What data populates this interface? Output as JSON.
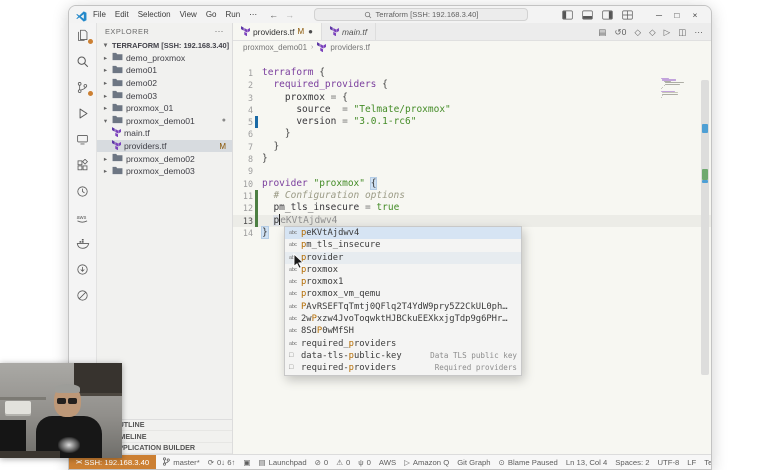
{
  "title_bar": {
    "menus": [
      "File",
      "Edit",
      "Selection",
      "View",
      "Go",
      "Run"
    ],
    "more_menu": "⋯",
    "back_arrow": "←",
    "forward_arrow": "→",
    "search_text": "Terraform [SSH: 192.168.3.40]",
    "window_controls": {
      "minimize": "─",
      "maximize": "□",
      "close": "×"
    }
  },
  "activity_bar": [
    {
      "name": "explorer",
      "badge": true
    },
    {
      "name": "search",
      "badge": false
    },
    {
      "name": "source-control",
      "badge": true
    },
    {
      "name": "run-debug",
      "badge": false
    },
    {
      "name": "remote-explorer",
      "badge": false
    },
    {
      "name": "extensions",
      "badge": false
    },
    {
      "name": "clock",
      "badge": false
    },
    {
      "name": "aws",
      "badge": false
    },
    {
      "name": "docker",
      "badge": false
    },
    {
      "name": "circle-arrow",
      "badge": false
    },
    {
      "name": "blocked-circle",
      "badge": false
    }
  ],
  "explorer": {
    "header": "EXPLORER",
    "header_more": "⋯",
    "root": "TERRAFORM [SSH: 192.168.3.40]",
    "items": [
      {
        "label": "demo_proxmox",
        "kind": "folder"
      },
      {
        "label": "demo01",
        "kind": "folder"
      },
      {
        "label": "demo02",
        "kind": "folder"
      },
      {
        "label": "demo03",
        "kind": "folder"
      },
      {
        "label": "proxmox_01",
        "kind": "folder"
      },
      {
        "label": "proxmox_demo01",
        "kind": "folder",
        "expanded": true,
        "dirty": true
      },
      {
        "label": "main.tf",
        "kind": "file",
        "depth": 1
      },
      {
        "label": "providers.tf",
        "kind": "file",
        "depth": 1,
        "selected": true,
        "git": "M"
      },
      {
        "label": "proxmox_demo02",
        "kind": "folder"
      },
      {
        "label": "proxmox_demo03",
        "kind": "folder"
      }
    ],
    "bottom_sections": [
      "OUTLINE",
      "TIMELINE",
      "APPLICATION BUILDER"
    ]
  },
  "editor": {
    "tabs": [
      {
        "label": "providers.tf",
        "git": "M",
        "dirty": true,
        "active": true
      },
      {
        "label": "main.tf",
        "preview": true
      }
    ],
    "actions": [
      "▤",
      "↺0",
      "◇",
      "◇",
      "▷",
      "◫",
      "⋯"
    ],
    "breadcrumb": [
      "proxmox_demo01",
      "providers.tf"
    ],
    "code_lines": [
      {
        "n": 1,
        "tokens": [
          [
            "kw",
            "terraform"
          ],
          [
            "pun",
            " {"
          ]
        ]
      },
      {
        "n": 2,
        "tokens": [
          [
            "pun",
            "  "
          ],
          [
            "kw",
            "required_providers"
          ],
          [
            "pun",
            " {"
          ]
        ]
      },
      {
        "n": 3,
        "tokens": [
          [
            "pun",
            "    "
          ],
          [
            "prop",
            "proxmox"
          ],
          [
            "op",
            " = "
          ],
          [
            "pun",
            "{"
          ]
        ]
      },
      {
        "n": 4,
        "tokens": [
          [
            "pun",
            "      "
          ],
          [
            "prop",
            "source"
          ],
          [
            "op",
            "  = "
          ],
          [
            "str",
            "\"Telmate/proxmox\""
          ]
        ]
      },
      {
        "n": 5,
        "mark": "mod",
        "tokens": [
          [
            "pun",
            "      "
          ],
          [
            "prop",
            "version"
          ],
          [
            "op",
            " = "
          ],
          [
            "str",
            "\"3.0.1-rc6\""
          ]
        ]
      },
      {
        "n": 6,
        "tokens": [
          [
            "pun",
            "    }"
          ]
        ]
      },
      {
        "n": 7,
        "tokens": [
          [
            "pun",
            "  }"
          ]
        ]
      },
      {
        "n": 8,
        "tokens": [
          [
            "pun",
            "}"
          ]
        ]
      },
      {
        "n": 9,
        "tokens": []
      },
      {
        "n": 10,
        "tokens": [
          [
            "kw",
            "provider"
          ],
          [
            "pun",
            " "
          ],
          [
            "str",
            "\"proxmox\""
          ],
          [
            "pun",
            " "
          ],
          [
            "brh",
            "{"
          ]
        ]
      },
      {
        "n": 11,
        "mark": "add",
        "tokens": [
          [
            "pun",
            "  "
          ],
          [
            "com",
            "# Configuration options"
          ]
        ]
      },
      {
        "n": 12,
        "mark": "add",
        "tokens": [
          [
            "pun",
            "  "
          ],
          [
            "prop",
            "pm_tls_insecure"
          ],
          [
            "op",
            " = "
          ],
          [
            "bool",
            "true"
          ]
        ]
      },
      {
        "n": 13,
        "mark": "add",
        "current": true,
        "cursor": true,
        "ghost": "eKVtAjdwv4",
        "tokens": [
          [
            "pun",
            "  "
          ],
          [
            "wordhl",
            "p"
          ]
        ]
      },
      {
        "n": 14,
        "tokens": [
          [
            "brh",
            "}"
          ]
        ]
      }
    ]
  },
  "suggest": {
    "items": [
      {
        "pre": "",
        "match": "p",
        "post": "eKVtAjdwv4",
        "kind": "text",
        "state": "selected"
      },
      {
        "pre": "",
        "match": "p",
        "post": "m_tls_insecure",
        "kind": "text"
      },
      {
        "pre": "",
        "match": "p",
        "post": "rovider",
        "kind": "text",
        "state": "hover"
      },
      {
        "pre": "",
        "match": "p",
        "post": "roxmox",
        "kind": "text"
      },
      {
        "pre": "",
        "match": "p",
        "post": "roxmox1",
        "kind": "text"
      },
      {
        "pre": "",
        "match": "p",
        "post": "roxmox_vm_qemu",
        "kind": "text"
      },
      {
        "pre": "",
        "match": "P",
        "post": "AvRSEFTqTmtj0QFlq2T4YdW9pry5Z2CkUL0ph…",
        "kind": "text"
      },
      {
        "pre": "2w",
        "match": "P",
        "post": "xzw4JvoToqwktHJBCkuEEXkxjgTdp9g6PHr…",
        "kind": "text"
      },
      {
        "pre": "8Sd",
        "match": "P",
        "post": "0wMfSH",
        "kind": "text"
      },
      {
        "pre": "required_",
        "match": "p",
        "post": "roviders",
        "kind": "text"
      },
      {
        "pre": "data-tls-",
        "match": "p",
        "post": "ublic-key",
        "kind": "field",
        "detail": "Data TLS public key"
      },
      {
        "pre": "required-",
        "match": "p",
        "post": "roviders",
        "kind": "field",
        "detail": "Required providers"
      }
    ]
  },
  "status_bar": {
    "remote": {
      "label": "SSH: 192.168.3.40"
    },
    "left": [
      {
        "icon": "branch",
        "label": "master*"
      },
      {
        "icon": "sync",
        "label": "0↓ 6↑"
      },
      {
        "icon": "box",
        "label": ""
      },
      {
        "icon": "grid",
        "label": "Launchpad"
      },
      {
        "icon": "error",
        "label": "0"
      },
      {
        "icon": "warning",
        "label": "0"
      },
      {
        "icon": "tower",
        "label": "0"
      },
      {
        "icon": "",
        "label": "AWS"
      },
      {
        "icon": "play",
        "label": "Amazon Q"
      },
      {
        "icon": "",
        "label": "Git Graph"
      }
    ],
    "right": [
      {
        "icon": "blame",
        "label": "Blame Paused"
      },
      {
        "icon": "",
        "label": "Ln 13, Col 4"
      },
      {
        "icon": "",
        "label": "Spaces: 2"
      },
      {
        "icon": "",
        "label": "UTF-8"
      },
      {
        "icon": "",
        "label": "LF"
      },
      {
        "icon": "",
        "label": "Terraform"
      },
      {
        "icon": "bell",
        "label": ""
      }
    ]
  },
  "colors": {
    "remote_bg": "#cc8033",
    "badge": "#cc8033",
    "keyword": "#7a3e9d",
    "string": "#448c27",
    "comment": "#9b9b86",
    "match": "#b36b00",
    "git_modified": "#1b6aa5",
    "git_added": "#4d7f43",
    "terraform_purple": "#7b42bc"
  }
}
